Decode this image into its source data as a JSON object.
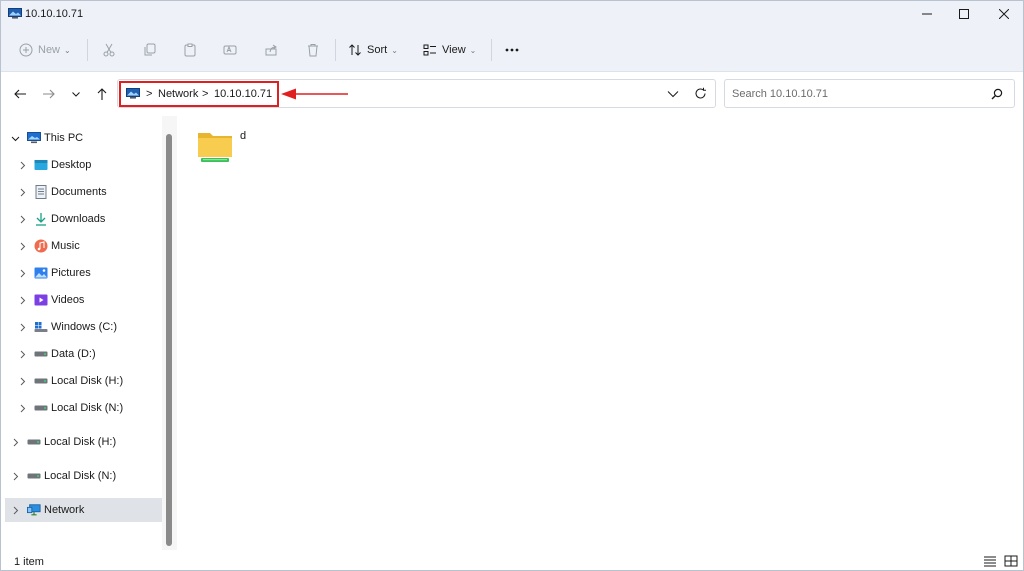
{
  "window": {
    "title": "10.10.10.71",
    "controls": [
      "minimize",
      "maximize",
      "close"
    ]
  },
  "toolbar": {
    "new_label": "New",
    "sort_label": "Sort",
    "view_label": "View",
    "disabled_actions": [
      "cut",
      "copy",
      "paste",
      "rename",
      "share",
      "delete"
    ],
    "more_label": "..."
  },
  "address": {
    "breadcrumb": [
      "Network",
      "10.10.10.71"
    ],
    "separator": ">"
  },
  "search": {
    "placeholder": "Search 10.10.10.71"
  },
  "sidebar": {
    "root": "This PC",
    "items": [
      {
        "label": "Desktop",
        "icon": "desktop-icon"
      },
      {
        "label": "Documents",
        "icon": "documents-icon"
      },
      {
        "label": "Downloads",
        "icon": "downloads-icon"
      },
      {
        "label": "Music",
        "icon": "music-icon"
      },
      {
        "label": "Pictures",
        "icon": "pictures-icon"
      },
      {
        "label": "Videos",
        "icon": "videos-icon"
      },
      {
        "label": "Windows (C:)",
        "icon": "windows-drive-icon"
      },
      {
        "label": "Data (D:)",
        "icon": "drive-icon"
      },
      {
        "label": "Local Disk (H:)",
        "icon": "drive-icon"
      },
      {
        "label": "Local Disk (N:)",
        "icon": "drive-icon"
      }
    ],
    "extra": [
      {
        "label": "Local Disk (H:)",
        "icon": "drive-icon"
      },
      {
        "label": "Local Disk (N:)",
        "icon": "drive-icon"
      }
    ],
    "network": {
      "label": "Network",
      "icon": "network-icon",
      "selected": true
    }
  },
  "content": {
    "items": [
      {
        "name": "d",
        "type": "shared-folder"
      }
    ]
  },
  "status": {
    "item_count": "1 item"
  },
  "colors": {
    "accent": "#0067c0",
    "highlight": "#e02020",
    "folder": "#f5c842",
    "selection": "#dfe3e8"
  }
}
